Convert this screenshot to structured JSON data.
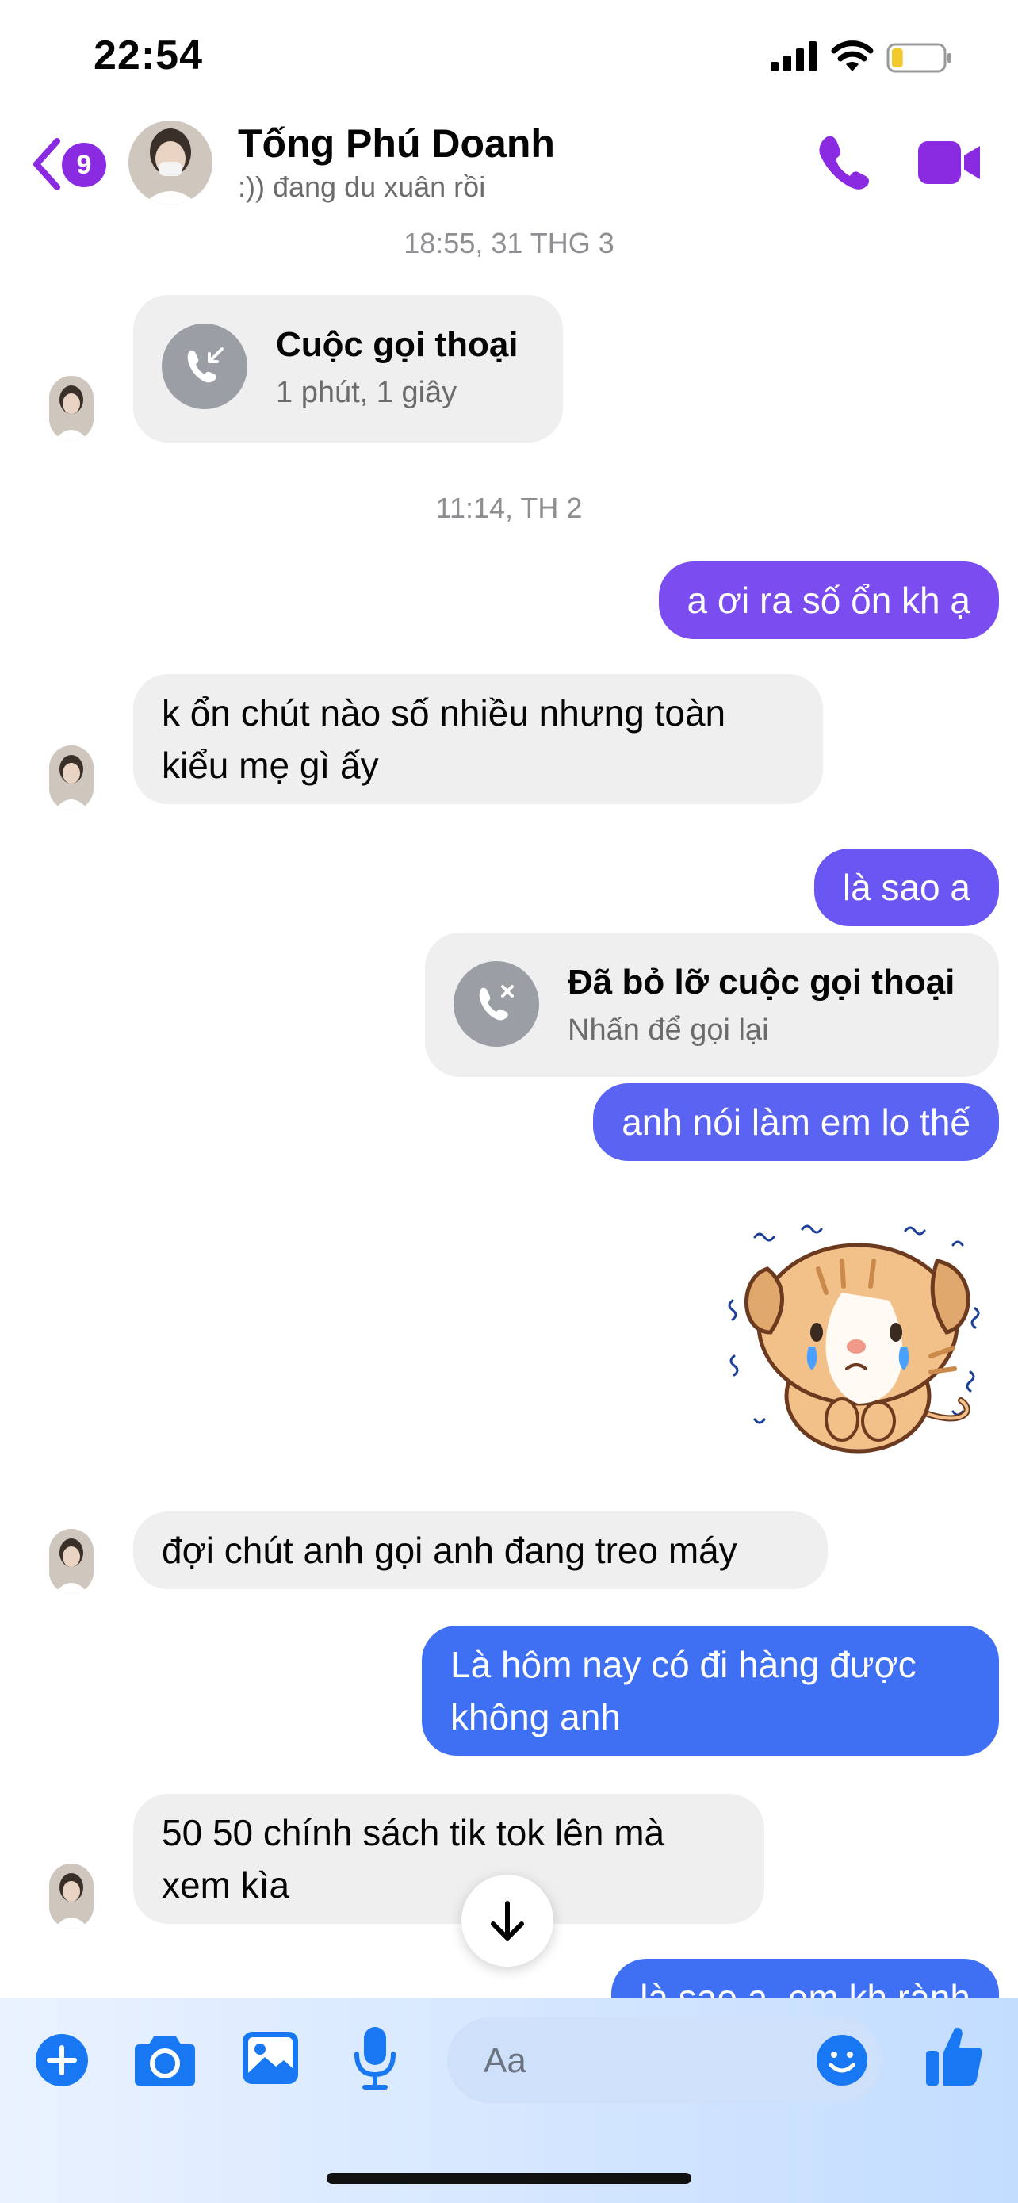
{
  "status_bar": {
    "time": "22:54",
    "battery_level": 0.22
  },
  "header": {
    "unread_badge": "9",
    "contact_name": "Tống Phú Doanh",
    "status_text": ":)) đang du xuân rồi",
    "icons": [
      "back-chevron-icon",
      "phone-icon",
      "video-camera-icon"
    ]
  },
  "timestamps": [
    "18:55, 31 THG 3",
    "11:14, TH 2"
  ],
  "call_cards": [
    {
      "title": "Cuộc gọi thoại",
      "detail": "1 phút, 1 giây",
      "direction": "incoming",
      "icon": "incoming-call-icon"
    },
    {
      "title": "Đã bỏ lỡ cuộc gọi thoại",
      "detail": "Nhấn để gọi lại",
      "direction": "outgoing",
      "icon": "missed-call-icon"
    }
  ],
  "messages": [
    {
      "from": "me",
      "text": "a ơi ra số ổn kh ạ"
    },
    {
      "from": "them",
      "line1": "k ổn chút nào số nhiều nhưng toàn",
      "line2": "kiểu mẹ gì ấy"
    },
    {
      "from": "me",
      "text": "là sao a"
    },
    {
      "from": "me",
      "text": "anh nói làm em lo thế"
    },
    {
      "from": "me",
      "type": "sticker",
      "icon": "crying-cat-sticker"
    },
    {
      "from": "them",
      "text": "đợi chút anh gọi anh đang treo máy"
    },
    {
      "from": "me",
      "line1": "Là hôm nay có đi hàng được",
      "line2": "không anh"
    },
    {
      "from": "them",
      "line1": "50 50 chính sách tik tok lên mà",
      "line2": "xem kìa"
    },
    {
      "from": "me",
      "text": "là sao a, em kh rành"
    }
  ],
  "colors": {
    "accent": "#8a2be2",
    "bubble_purple": "#7b4cf0",
    "bubble_blue": "#3f6ff2",
    "bubble_incoming": "#efefef"
  },
  "composer": {
    "placeholder": "Aa",
    "icons": [
      "plus-icon",
      "camera-icon",
      "image-icon",
      "microphone-icon",
      "emoji-icon",
      "thumbs-up-icon"
    ]
  },
  "scroll_button_icon": "arrow-down-icon"
}
